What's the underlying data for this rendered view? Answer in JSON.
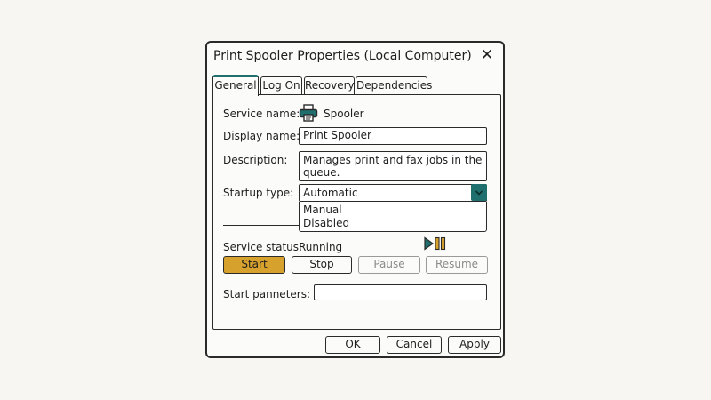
{
  "dialog": {
    "title": "Print Spooler Properties (Local Computer)",
    "close_glyph": "✕"
  },
  "tabs": [
    {
      "label": "General",
      "active": true
    },
    {
      "label": "Log On",
      "active": false
    },
    {
      "label": "Recovery",
      "active": false
    },
    {
      "label": "Dependencies",
      "active": false
    }
  ],
  "general": {
    "service_name_label": "Service name:",
    "service_name_value": "Spooler",
    "service_icon": "printer-icon",
    "display_name_label": "Display name:",
    "display_name_value": "Print Spooler",
    "description_label": "Description:",
    "description_value": "Manages print and fax jobs in the queue.",
    "startup_type_label": "Startup type:",
    "startup_type_value": "Automatic",
    "startup_options": [
      "Manual",
      "Disabled"
    ],
    "service_status_label": "Service status:",
    "service_status_value": "Running",
    "status_icon": "play-pause-icon",
    "buttons": {
      "start": "Start",
      "stop": "Stop",
      "pause": "Pause",
      "resume": "Resume"
    },
    "start_params_label": "Start panneters:",
    "start_params_value": ""
  },
  "footer": {
    "ok": "OK",
    "cancel": "Cancel",
    "apply": "Apply"
  },
  "colors": {
    "accent_teal": "#1f6f6e",
    "accent_gold": "#d7a12e",
    "border": "#2a2a2a",
    "background": "#f7f6f3"
  }
}
